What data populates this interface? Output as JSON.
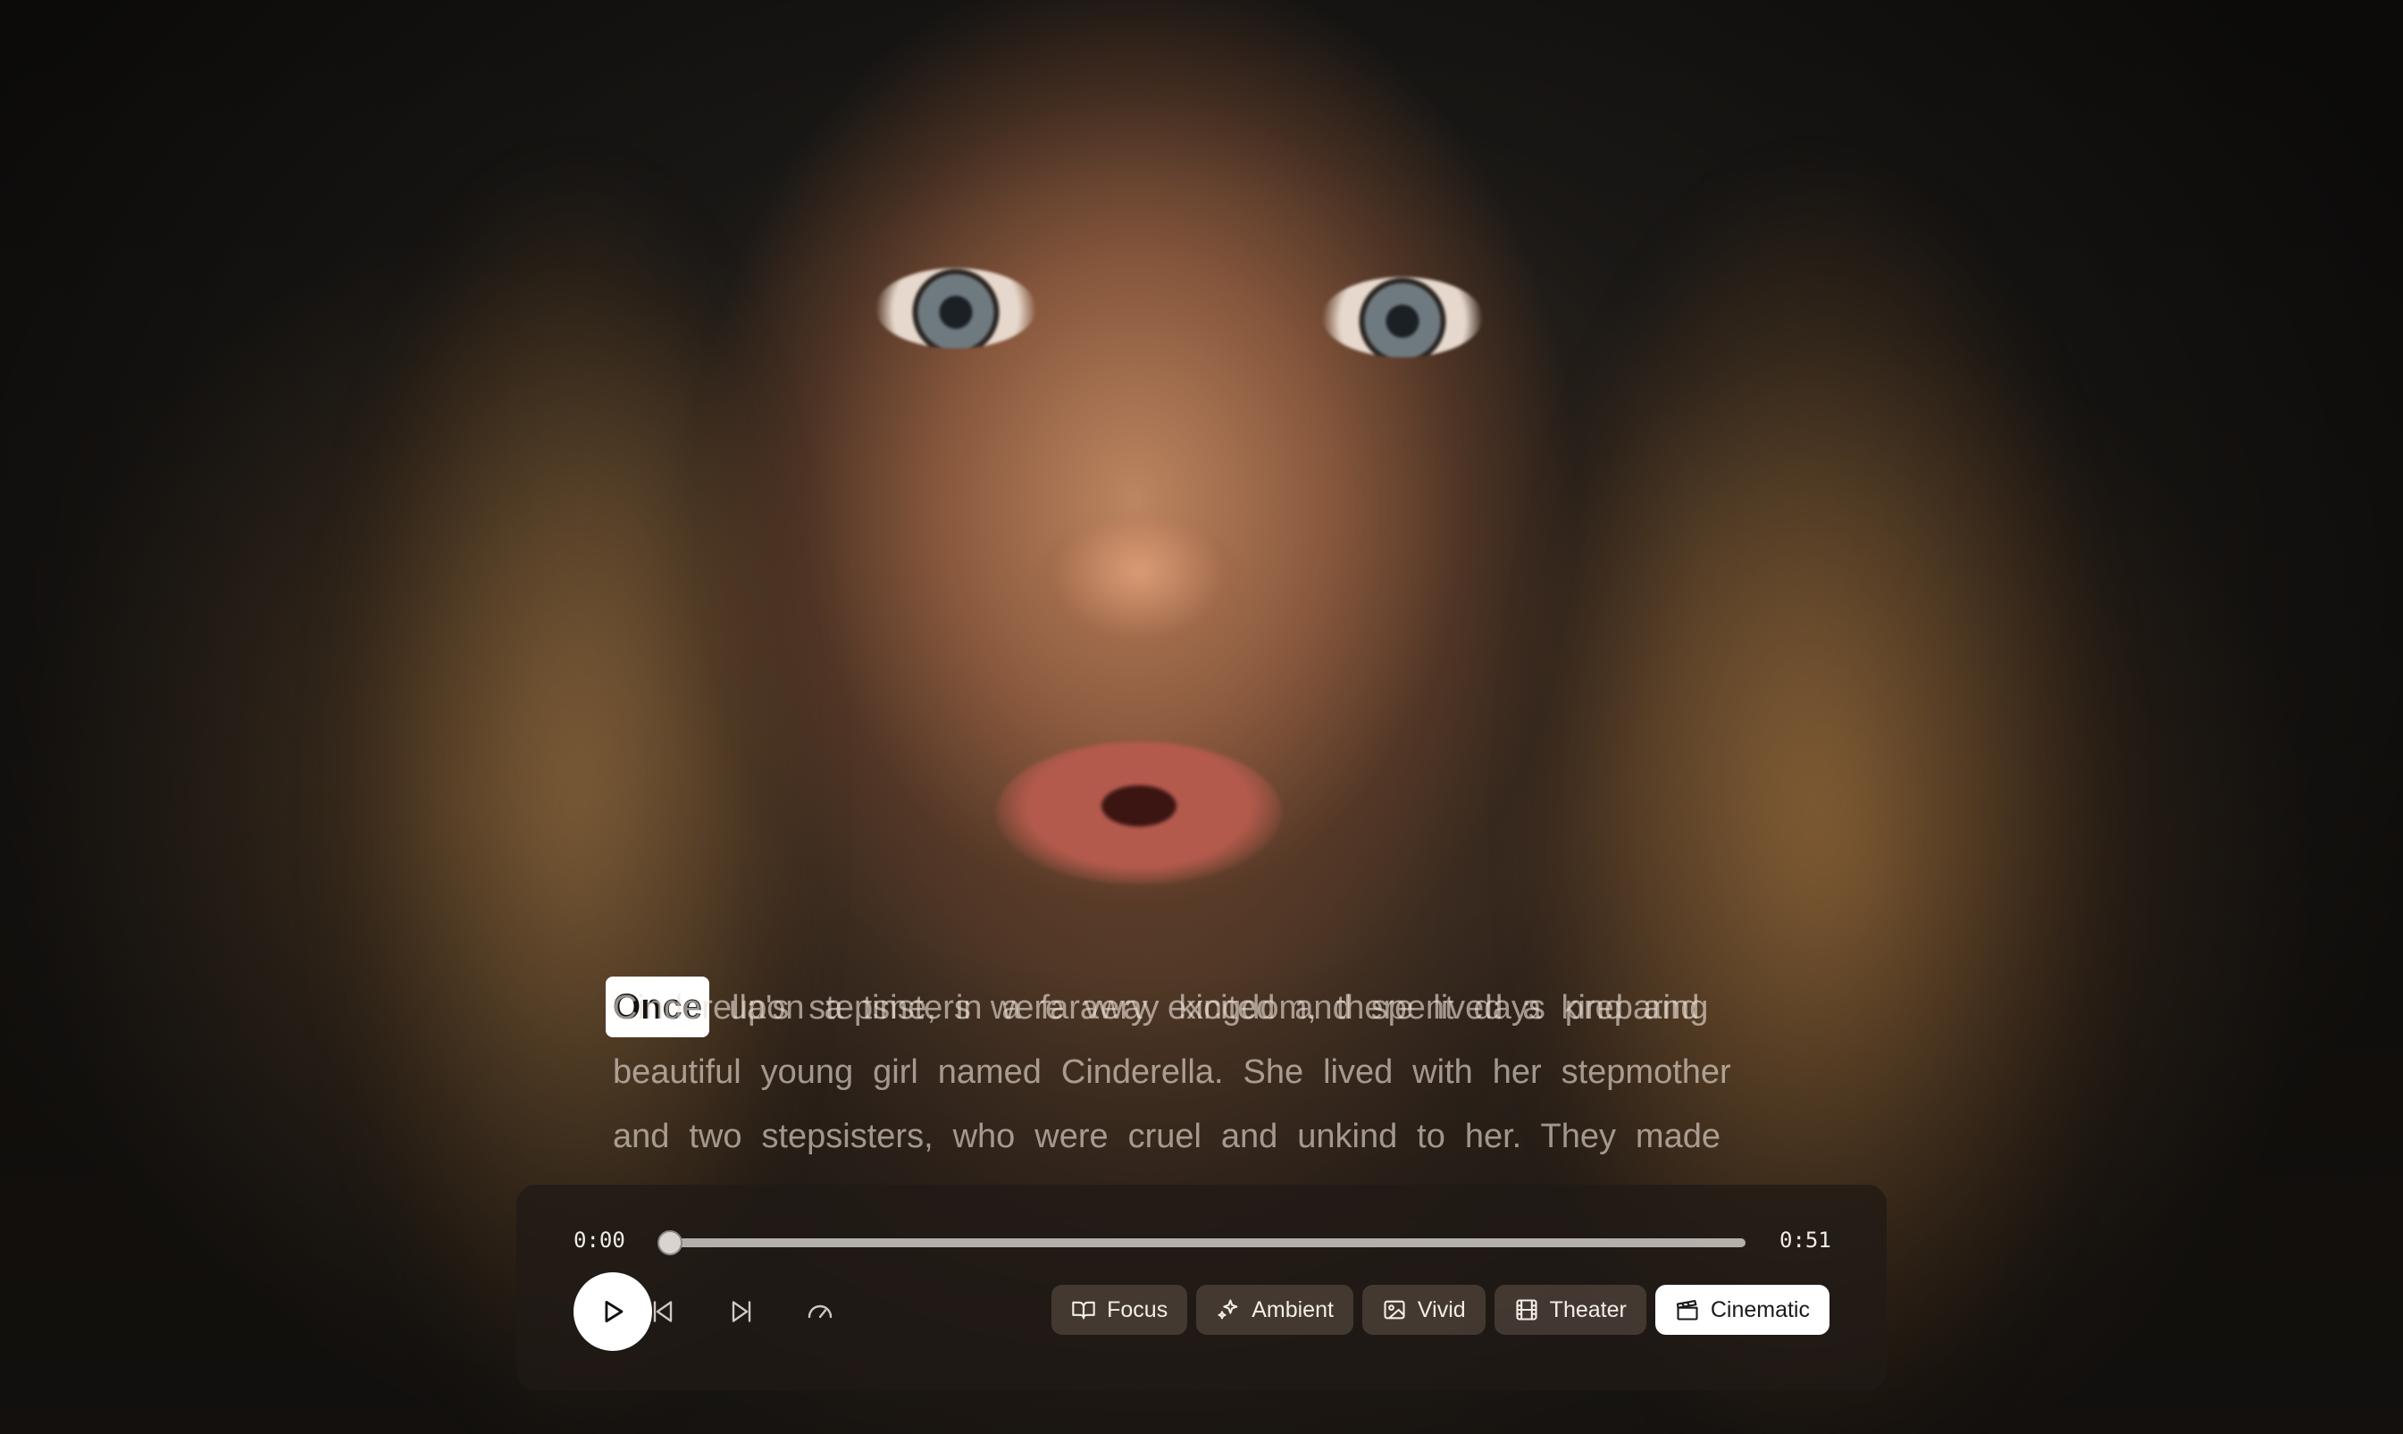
{
  "transcript": {
    "current_word": "Once",
    "line1_rest": "upon a time, in a faraway kingdom, there lived a kind and",
    "line2": "beautiful young girl named Cinderella. She lived with her stepmother",
    "line3": "and two stepsisters, who were cruel and unkind to her. They made",
    "partial_line": "Cinderella's stepsisters were very excited and spent days preparing"
  },
  "player": {
    "current_time": "0:00",
    "duration": "0:51",
    "progress": 0,
    "modes": [
      {
        "label": "Focus",
        "icon": "book-open-icon",
        "active": false
      },
      {
        "label": "Ambient",
        "icon": "sparkles-icon",
        "active": false
      },
      {
        "label": "Vivid",
        "icon": "image-icon",
        "active": false
      },
      {
        "label": "Theater",
        "icon": "film-icon",
        "active": false
      },
      {
        "label": "Cinematic",
        "icon": "clapperboard-icon",
        "active": true
      }
    ],
    "controls": {
      "play_icon": "play-icon",
      "previous_icon": "skip-back-icon",
      "next_icon": "skip-forward-icon",
      "speed_icon": "gauge-icon"
    }
  }
}
